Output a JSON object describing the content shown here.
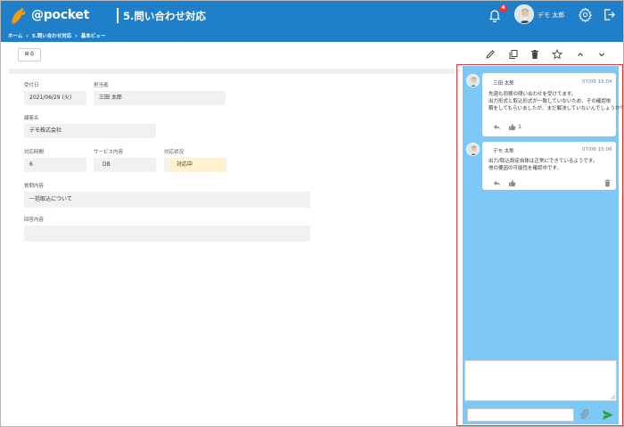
{
  "header": {
    "logo_text": "@pocket",
    "logo_sub": "",
    "title": "5.問い合わせ対応",
    "notification_count": "4",
    "user_name": "デモ 太郎",
    "brand_color": "#1f7fc8"
  },
  "breadcrumb": {
    "items": [
      "ホーム",
      "5.問い合わせ対応",
      "基本ビュー"
    ]
  },
  "toolbar": {
    "back_label": "戻る",
    "icons": [
      "edit-icon",
      "copy-icon",
      "delete-icon",
      "star-icon",
      "chevron-up-icon",
      "chevron-down-icon"
    ]
  },
  "form": {
    "reception_date": {
      "label": "受付日",
      "value": "2021/06/29 (火)"
    },
    "assignee": {
      "label": "担当者",
      "value": "三田 太郎"
    },
    "customer": {
      "label": "顧客名",
      "value": "デモ株式会社"
    },
    "response_time": {
      "label": "対応時間",
      "value": "6"
    },
    "service": {
      "label": "サービス内容",
      "value": "DB"
    },
    "status": {
      "label": "対応状況",
      "value": "対応中"
    },
    "question": {
      "label": "質問内容",
      "value": "一括取込について"
    },
    "answer": {
      "label": "回答内容",
      "value": ""
    }
  },
  "comments": [
    {
      "author": "三田 太郎",
      "time": "07/06 15:04",
      "lines": [
        "先週も同様の問い合わせを受けてます。",
        "出力形式と取込形式が一致していないため、その確認依",
        "頼をしてもらいましたが、まだ解決していないんでしょうか？"
      ],
      "likes": "1",
      "actions": [
        "reply-icon",
        "thumbs-up-icon"
      ]
    },
    {
      "author": "デモ 太郎",
      "time": "07/06 15:06",
      "lines": [
        "出力/取込設定自体は正常にできているようです。",
        "他の要因の可能性を確認中です。"
      ],
      "likes": "",
      "actions": [
        "reply-icon",
        "thumbs-up-icon",
        "trash-icon"
      ]
    }
  ],
  "comment_input": {
    "value": "",
    "placeholder": ""
  },
  "colors": {
    "panel_bg": "#7ec8f8",
    "highlight_border": "#e53935",
    "status_bg": "#fff2cc",
    "send": "#2e9e3e"
  }
}
